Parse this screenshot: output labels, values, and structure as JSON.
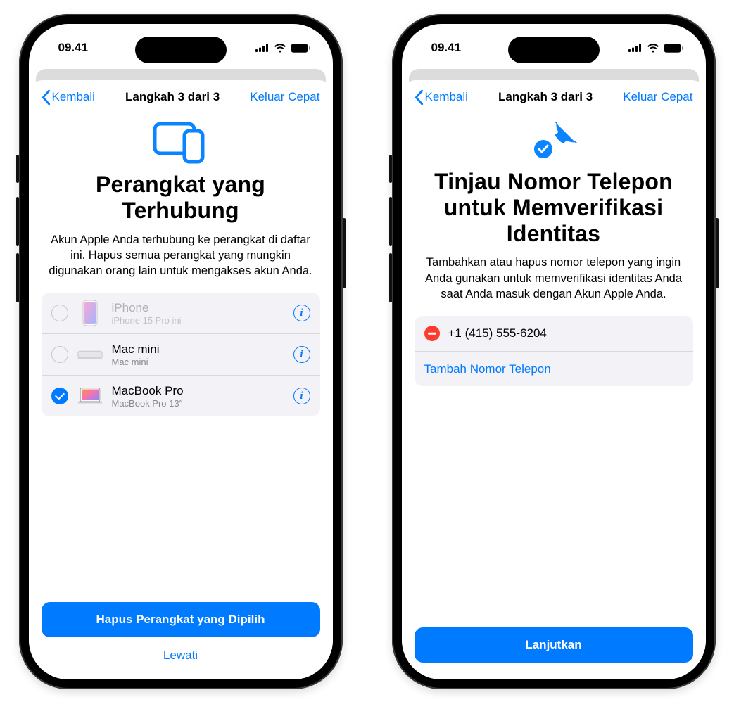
{
  "status": {
    "time": "09.41"
  },
  "left": {
    "nav": {
      "back": "Kembali",
      "title": "Langkah 3 dari 3",
      "right": "Keluar Cepat"
    },
    "hero": {
      "title": "Perangkat yang\nTerhubung",
      "desc": "Akun Apple Anda terhubung ke perangkat di daftar ini. Hapus semua perangkat yang mungkin digunakan orang lain untuk mengakses akun Anda."
    },
    "devices": [
      {
        "name": "iPhone",
        "sub": "iPhone 15 Pro ini",
        "selected": false,
        "disabled": true
      },
      {
        "name": "Mac mini",
        "sub": "Mac mini",
        "selected": false,
        "disabled": false
      },
      {
        "name": "MacBook Pro",
        "sub": "MacBook Pro 13″",
        "selected": true,
        "disabled": false
      }
    ],
    "primary": "Hapus Perangkat yang Dipilih",
    "skip": "Lewati"
  },
  "right": {
    "nav": {
      "back": "Kembali",
      "title": "Langkah 3 dari 3",
      "right": "Keluar Cepat"
    },
    "hero": {
      "title": "Tinjau Nomor Telepon untuk Memverifikasi Identitas",
      "desc": "Tambahkan atau hapus nomor telepon yang ingin Anda gunakan untuk memverifikasi identitas Anda saat Anda masuk dengan Akun Apple Anda."
    },
    "phone": "+1 (415) 555-6204",
    "add": "Tambah Nomor Telepon",
    "primary": "Lanjutkan"
  }
}
